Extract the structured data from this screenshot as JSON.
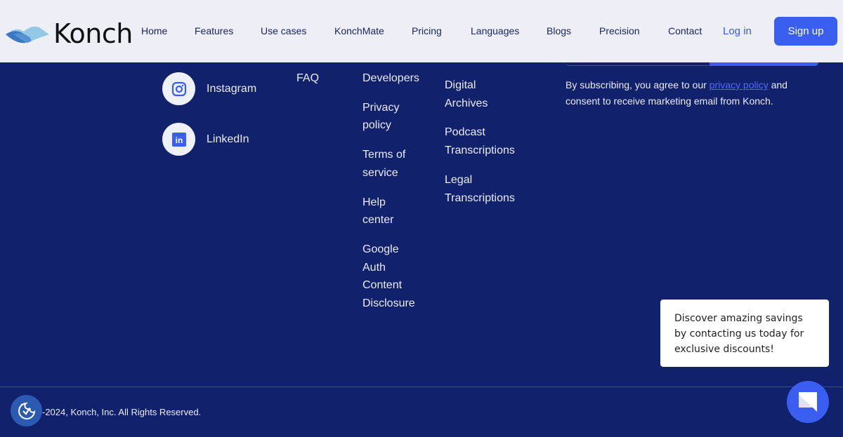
{
  "header": {
    "brand": "Konch",
    "nav": [
      "Home",
      "Features",
      "Use cases",
      "KonchMate",
      "Pricing",
      "Languages",
      "Blogs",
      "Precision",
      "Contact"
    ],
    "login": "Log in",
    "signup": "Sign up"
  },
  "social": [
    {
      "label": "Instagram",
      "icon": "instagram-icon"
    },
    {
      "label": "LinkedIn",
      "icon": "linkedin-icon"
    }
  ],
  "columns": {
    "col1": [
      "FAQ"
    ],
    "col2": [
      "Developers",
      "Privacy policy",
      "Terms of service",
      "Help center",
      "Google Auth Content Disclosure"
    ],
    "col3": [
      "Digital Archives",
      "Podcast Transcriptions",
      "Legal Transcriptions"
    ]
  },
  "consent": {
    "before": "By subscribing, you agree to our ",
    "link": "privacy policy",
    "after": " and consent to receive marketing email from Konch."
  },
  "footer": {
    "copyright": "-2024, Konch, Inc. All Rights Reserved."
  },
  "popup": {
    "text": "Discover amazing savings by contacting us today for exclusive discounts!"
  },
  "colors": {
    "background": "#12216c",
    "accent": "#3a5ef0",
    "header": "#eeeff6"
  }
}
